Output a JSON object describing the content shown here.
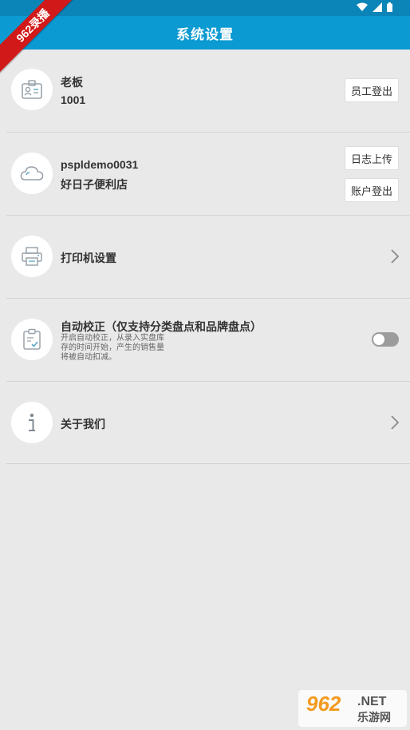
{
  "status": {
    "icons": [
      "wifi-icon",
      "signal-icon",
      "battery-icon"
    ]
  },
  "ribbon": {
    "text": "962录播"
  },
  "header": {
    "title": "系统设置"
  },
  "employee": {
    "name": "老板",
    "id": "1001",
    "logout_label": "员工登出"
  },
  "account": {
    "username": "pspldemo0031",
    "store": "好日子便利店",
    "upload_log_label": "日志上传",
    "logout_label": "账户登出"
  },
  "printer": {
    "label": "打印机设置"
  },
  "auto_correct": {
    "title": "自动校正（仅支持分类盘点和品牌盘点）",
    "desc_lines": [
      "开启自动校正，从录入实盘库",
      "存的时间开始，产生的销售量",
      "将被自动扣减。"
    ],
    "enabled": false
  },
  "about": {
    "label": "关于我们"
  },
  "watermark": {
    "brand": "962",
    "net": ".NET",
    "cn": "乐游网"
  },
  "colors": {
    "appbar": "#0b9ad1",
    "statusbar": "#0b84b8",
    "background": "#e9e9e9",
    "ribbon": "#d21919"
  }
}
